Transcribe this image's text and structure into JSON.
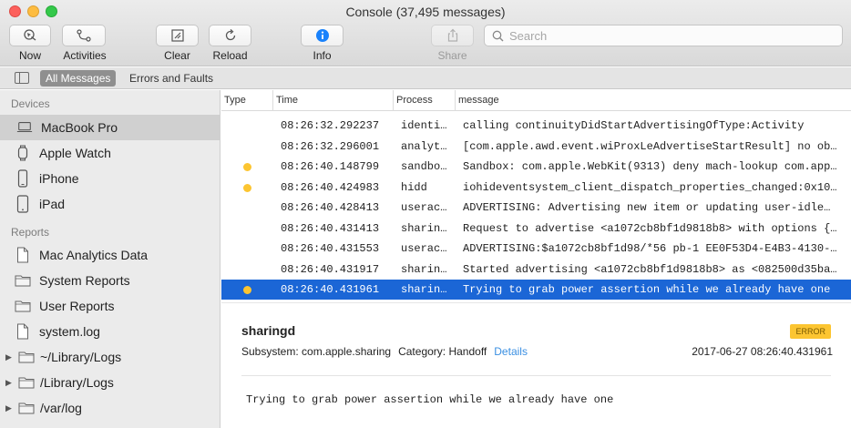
{
  "window": {
    "title": "Console (37,495 messages)"
  },
  "toolbar": {
    "now_label": "Now",
    "activities_label": "Activities",
    "clear_label": "Clear",
    "reload_label": "Reload",
    "info_label": "Info",
    "share_label": "Share",
    "search_placeholder": "Search"
  },
  "filters": {
    "all_messages": "All Messages",
    "errors_faults": "Errors and Faults"
  },
  "sidebar": {
    "devices_header": "Devices",
    "devices": [
      {
        "label": "MacBook Pro",
        "icon": "laptop-icon",
        "selected": true
      },
      {
        "label": "Apple Watch",
        "icon": "watch-icon"
      },
      {
        "label": "iPhone",
        "icon": "iphone-icon"
      },
      {
        "label": "iPad",
        "icon": "ipad-icon"
      }
    ],
    "reports_header": "Reports",
    "reports": [
      {
        "label": "Mac Analytics Data",
        "icon": "document-icon"
      },
      {
        "label": "System Reports",
        "icon": "folder-icon"
      },
      {
        "label": "User Reports",
        "icon": "folder-icon"
      },
      {
        "label": "system.log",
        "icon": "document-icon"
      },
      {
        "label": "~/Library/Logs",
        "icon": "folder-icon",
        "disclosure": true
      },
      {
        "label": "/Library/Logs",
        "icon": "folder-icon",
        "disclosure": true
      },
      {
        "label": "/var/log",
        "icon": "folder-icon",
        "disclosure": true
      }
    ]
  },
  "table": {
    "columns": [
      "Type",
      "Time",
      "Process",
      "message"
    ],
    "rows": [
      {
        "type": "",
        "time": "08:26:32.292237",
        "process": "identi…",
        "message": "calling continuityDidStartAdvertisingOfType:Activity"
      },
      {
        "type": "",
        "time": "08:26:32.296001",
        "process": "analyt…",
        "message": "[com.apple.awd.event.wiProxLeAdvertiseStartResult] no ob…"
      },
      {
        "type": "error",
        "time": "08:26:40.148799",
        "process": "sandbo…",
        "message": "Sandbox: com.apple.WebKit(9313) deny mach-lookup com.app…"
      },
      {
        "type": "error",
        "time": "08:26:40.424983",
        "process": "hidd",
        "message": "iohideventsystem_client_dispatch_properties_changed:0x10…"
      },
      {
        "type": "",
        "time": "08:26:40.428413",
        "process": "userac…",
        "message": "ADVERTISING: Advertising new item or updating user-idle…"
      },
      {
        "type": "",
        "time": "08:26:40.431413",
        "process": "sharin…",
        "message": "Request to advertise <a1072cb8bf1d9818b8> with options {…"
      },
      {
        "type": "",
        "time": "08:26:40.431553",
        "process": "userac…",
        "message": "ADVERTISING:$a1072cb8bf1d98/*56 pb-1 EE0F53D4-E4B3-4130-…"
      },
      {
        "type": "",
        "time": "08:26:40.431917",
        "process": "sharin…",
        "message": "Started advertising <a1072cb8bf1d9818b8> as <082500d35ba…"
      },
      {
        "type": "error",
        "time": "08:26:40.431961",
        "process": "sharin…",
        "message": "Trying to grab power assertion while we already have one",
        "selected": true
      }
    ]
  },
  "detail": {
    "process": "sharingd",
    "badge": "ERROR",
    "subsystem": "Subsystem: com.apple.sharing",
    "category": "Category: Handoff",
    "details_link": "Details",
    "timestamp": "2017-06-27 08:26:40.431961",
    "message": "Trying to grab power assertion while we already have one"
  },
  "colors": {
    "selection": "#1b66d6",
    "error_dot": "#fcc531",
    "info_accent": "#1a82fb",
    "link": "#3a8fe2"
  }
}
